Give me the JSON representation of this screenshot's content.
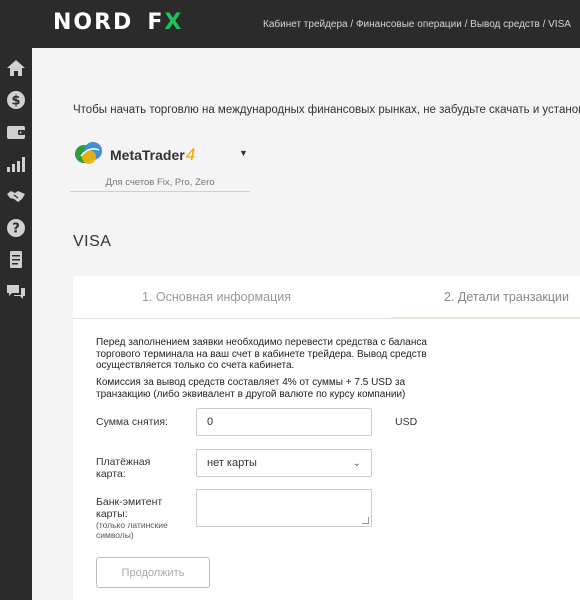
{
  "header": {
    "logo_part1": "NORD",
    "logo_part2": "F",
    "logo_part3": "X",
    "breadcrumb": "Кабинет трейдера / Финансовые операции / Вывод средств / VISA"
  },
  "sidebar": {
    "icons": [
      "home-icon",
      "dollar-icon",
      "wallet-icon",
      "chart-bars-icon",
      "handshake-icon",
      "help-icon",
      "document-icon",
      "chat-icon"
    ]
  },
  "notice": "Чтобы начать торговлю на международных финансовых рынках, не забудьте скачать и установить то",
  "platform": {
    "name": "MetaTrader",
    "version": "4",
    "subtitle": "Для счетов Fix, Pro, Zero"
  },
  "page_title": "VISA",
  "tabs": [
    {
      "label": "1. Основная информация"
    },
    {
      "label": "2. Детали транзакции"
    }
  ],
  "form": {
    "info_paragraph1": "Перед заполнением заявки необходимо перевести средства с баланса торгового терминала на ваш счет в кабинете трейдера. Вывод средств осуществляется только со счета кабинета.",
    "info_paragraph2": "Комиссия за вывод средств составляет 4% от суммы + 7.5 USD за транзакцию (либо эквивалент в другой валюте по курсу компании)",
    "amount_label": "Сумма снятия:",
    "amount_value": "0",
    "currency": "USD",
    "card_label_line1": "Платёжная",
    "card_label_line2": "карта:",
    "card_selected": "нет карты",
    "bank_label_line1": "Банк-эмитент",
    "bank_label_line2": "карты:",
    "bank_hint_line1": "(только латинские",
    "bank_hint_line2": "символы)",
    "bank_value": "",
    "continue_label": "Продолжить"
  },
  "colors": {
    "header_bg": "#2b2b2b",
    "logo_accent": "#1fc15a",
    "mt_accent": "#f0a400",
    "page_bg": "#f4f4f4"
  }
}
